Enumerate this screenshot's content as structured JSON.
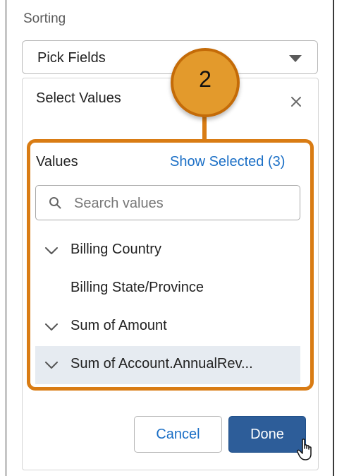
{
  "sorting": {
    "section_label": "Sorting",
    "field_select": {
      "value": "Pick Fields",
      "icon": "chevron-down-icon"
    }
  },
  "popover": {
    "title": "Select Values",
    "close_icon": "close-icon",
    "values_label": "Values",
    "show_selected_label": "Show Selected (3)",
    "search": {
      "placeholder": "Search values",
      "value": "",
      "icon": "search-icon"
    },
    "options": [
      {
        "label": "Billing Country",
        "selected": true
      },
      {
        "label": "Billing State/Province",
        "selected": false
      },
      {
        "label": "Sum of Amount",
        "selected": true
      },
      {
        "label": "Sum of Account.AnnualRev...",
        "selected": true,
        "hovered": true
      }
    ],
    "cancel_label": "Cancel",
    "done_label": "Done"
  },
  "annotation": {
    "step_number": "2",
    "color": "#d97c14"
  },
  "colors": {
    "link": "#1b6fc6",
    "primary_button": "#2d5d99",
    "hover_row": "#e6ebf1"
  }
}
